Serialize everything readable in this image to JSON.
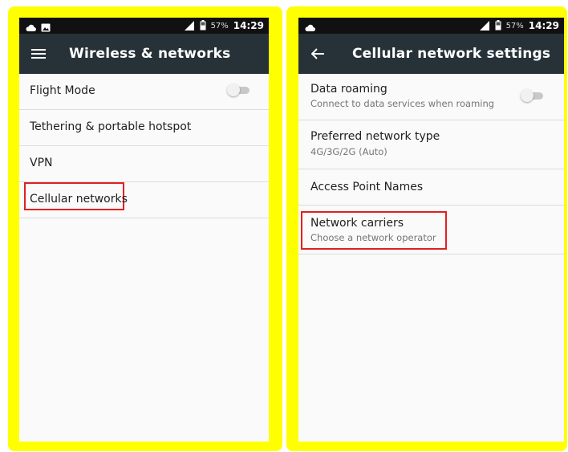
{
  "colors": {
    "frame": "#ffff00",
    "appbar": "#263238",
    "statusbar": "#111111",
    "highlight": "#e02020"
  },
  "left_screen": {
    "status_bar": {
      "left_icons": [
        "cloud-icon",
        "image-icon"
      ],
      "right_icons": [
        "signal-icon",
        "battery-icon"
      ],
      "battery": "57%",
      "time": "14:29"
    },
    "app_bar": {
      "nav_icon": "menu-icon",
      "title": "Wireless & networks"
    },
    "items": [
      {
        "label": "Flight Mode",
        "toggle": "off"
      },
      {
        "label": "Tethering & portable hotspot"
      },
      {
        "label": "VPN"
      },
      {
        "label": "Cellular networks",
        "highlighted": true
      }
    ]
  },
  "right_screen": {
    "status_bar": {
      "left_icons": [
        "cloud-icon"
      ],
      "right_icons": [
        "signal-icon",
        "battery-icon"
      ],
      "battery": "57%",
      "time": "14:29"
    },
    "app_bar": {
      "nav_icon": "back-arrow-icon",
      "title": "Cellular network settings"
    },
    "items": [
      {
        "label": "Data roaming",
        "sub": "Connect to data services when roaming",
        "toggle": "off"
      },
      {
        "label": "Preferred network type",
        "sub": "4G/3G/2G (Auto)"
      },
      {
        "label": "Access Point Names"
      },
      {
        "label": "Network carriers",
        "sub": "Choose a network operator",
        "highlighted": true
      }
    ]
  }
}
